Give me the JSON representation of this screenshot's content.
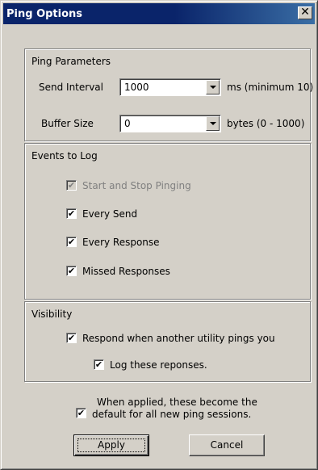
{
  "window": {
    "title": "Ping Options",
    "close_glyph": "✕"
  },
  "ping_parameters": {
    "title": "Ping Parameters",
    "send_interval": {
      "label": "Send Interval",
      "value": "1000",
      "hint": "ms (minimum 10)"
    },
    "buffer_size": {
      "label": "Buffer Size",
      "value": "0",
      "hint": "bytes (0 - 1000)"
    }
  },
  "events": {
    "title": "Events to Log",
    "items": [
      {
        "label": "Start and Stop Pinging",
        "checked": true,
        "disabled": true
      },
      {
        "label": "Every Send",
        "checked": true,
        "disabled": false
      },
      {
        "label": "Every Response",
        "checked": true,
        "disabled": false
      },
      {
        "label": "Missed Responses",
        "checked": true,
        "disabled": false
      }
    ]
  },
  "visibility": {
    "title": "Visibility",
    "respond_label": "Respond when another utility pings you",
    "log_label": "Log these reponses."
  },
  "defaults": {
    "line1": "When applied, these become the",
    "line2": "default for all new ping sessions."
  },
  "buttons": {
    "apply": "Apply",
    "cancel": "Cancel"
  },
  "check_glyph": "✔"
}
